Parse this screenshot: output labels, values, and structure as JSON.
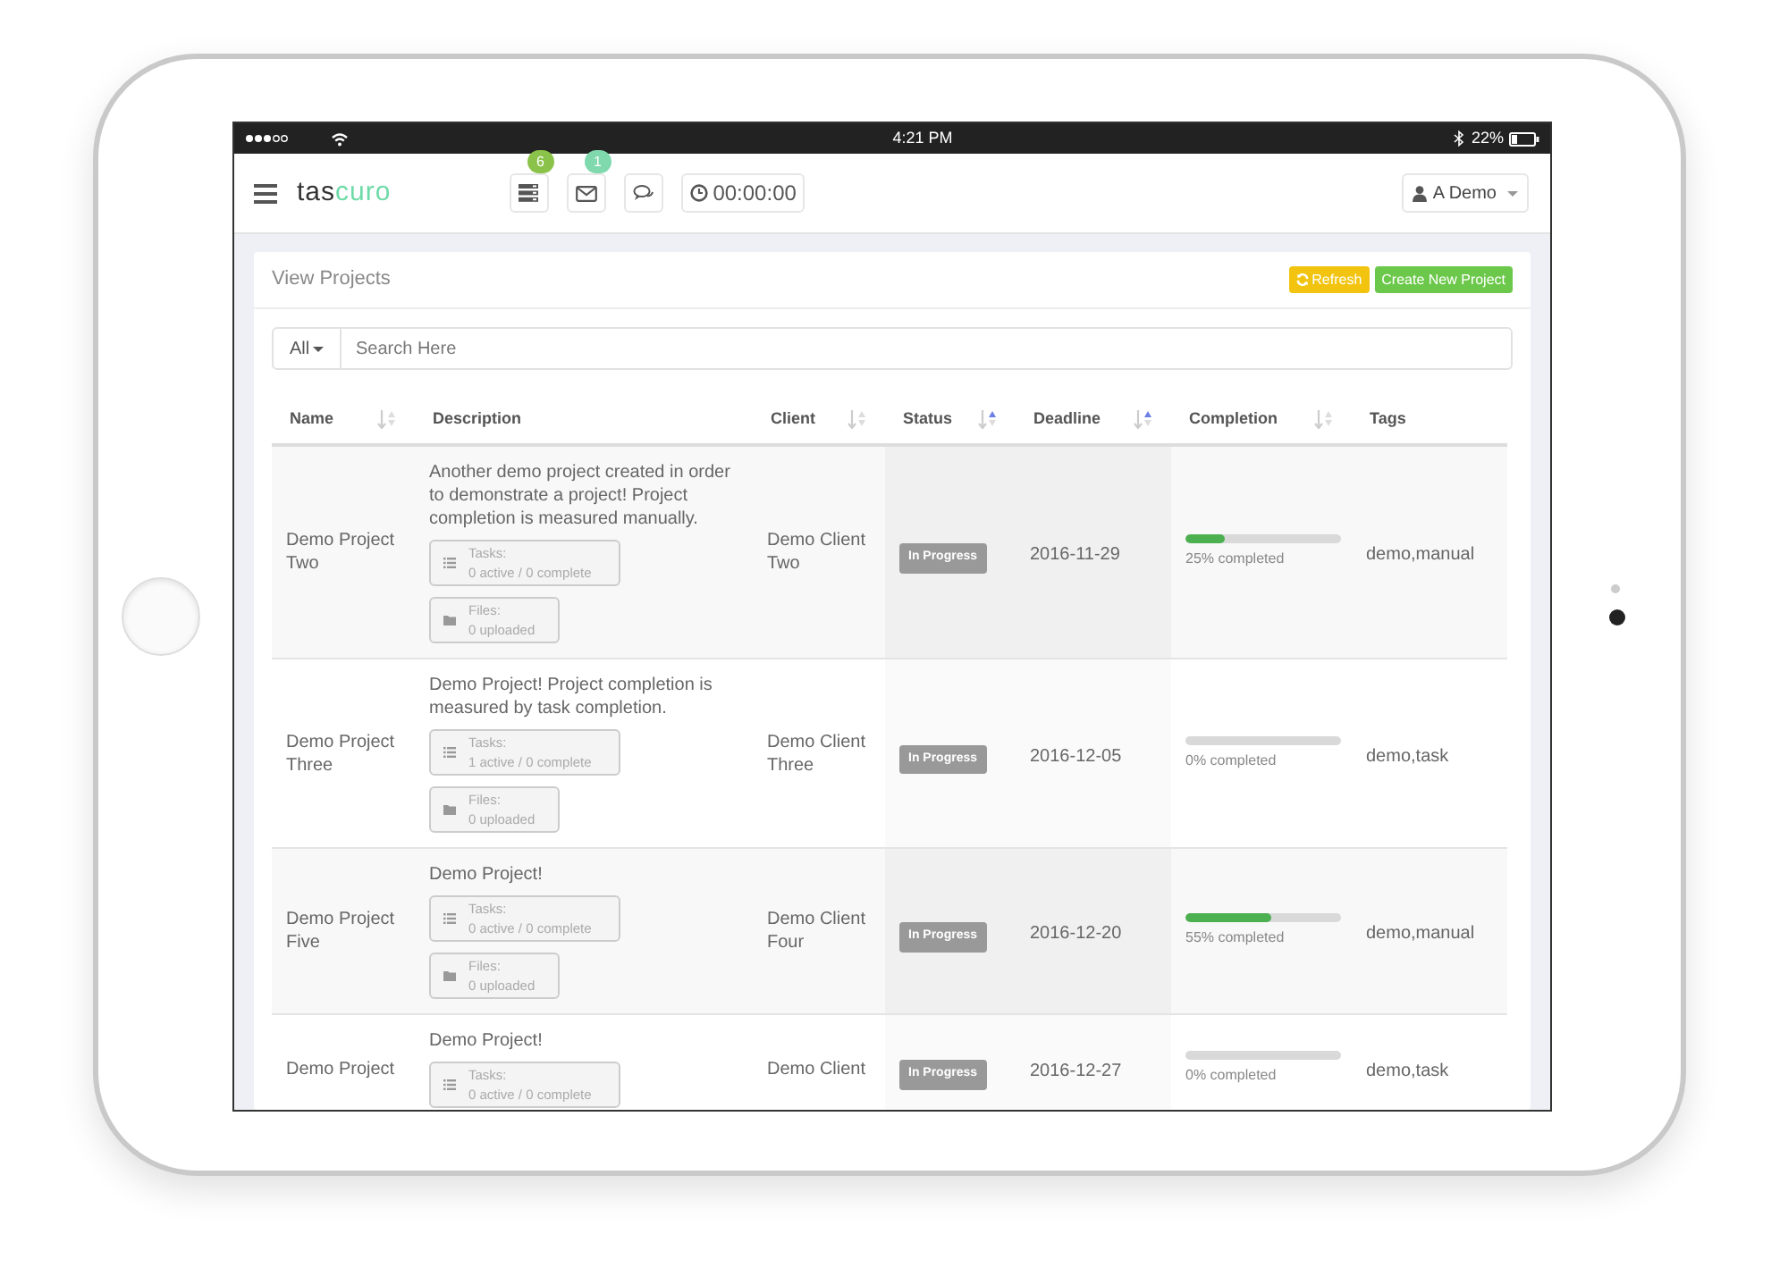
{
  "status_bar": {
    "time": "4:21 PM",
    "battery": "22%"
  },
  "header": {
    "logo": {
      "first": "tas",
      "second": "curo"
    },
    "icon_buttons": [
      {
        "kind": "tasks",
        "badge": "6",
        "color": "#8bc34a"
      },
      {
        "kind": "mail",
        "badge": "1",
        "color": "#7fd9ad"
      },
      {
        "kind": "chat"
      }
    ],
    "timer": "00:00:00",
    "user": "A Demo"
  },
  "panel": {
    "title": "View Projects",
    "buttons": [
      {
        "kind": "refresh",
        "label": "Refresh"
      },
      {
        "kind": "create",
        "label": "Create New Project"
      }
    ],
    "filter": "All",
    "search": {
      "placeholder": "Search Here"
    }
  },
  "table": {
    "columns": [
      {
        "label": "Name",
        "kind": "sortable",
        "sorted": false
      },
      {
        "label": "Description",
        "kind": "plain"
      },
      {
        "label": "Client",
        "kind": "sortable",
        "sorted": false
      },
      {
        "label": "Status",
        "kind": "sortable",
        "sorted": true
      },
      {
        "label": "Deadline",
        "kind": "sortable",
        "sorted": true
      },
      {
        "label": "Completion",
        "kind": "sortable",
        "sorted": false
      },
      {
        "label": "Tags",
        "kind": "plain"
      }
    ],
    "rows": [
      {
        "name": "Demo Project Two",
        "description": "Another demo project created in order to demonstrate a project! Project completion is measured manually.",
        "tasks_label": "Tasks:",
        "tasks": "0 active / 0 complete",
        "files_label": "Files:",
        "files": "0 uploaded",
        "client": "Demo Client Two",
        "status": "In Progress",
        "deadline": "2016-11-29",
        "level": 0.25,
        "completion": "25% completed",
        "tags": "demo,manual"
      },
      {
        "name": "Demo Project Three",
        "description": "Demo Project! Project completion is measured by task completion.",
        "tasks_label": "Tasks:",
        "tasks": "1 active / 0 complete",
        "files_label": "Files:",
        "files": "0 uploaded",
        "client": "Demo Client Three",
        "status": "In Progress",
        "deadline": "2016-12-05",
        "level": 0,
        "completion": "0% completed",
        "tags": "demo,task"
      },
      {
        "name": "Demo Project Five",
        "description": "Demo Project!",
        "tasks_label": "Tasks:",
        "tasks": "0 active / 0 complete",
        "files_label": "Files:",
        "files": "0 uploaded",
        "client": "Demo Client Four",
        "status": "In Progress",
        "deadline": "2016-12-20",
        "level": 0.55,
        "completion": "55% completed",
        "tags": "demo,manual"
      },
      {
        "name": "Demo Project",
        "description": "Demo Project!",
        "tasks_label": "Tasks:",
        "tasks": "0 active / 0 complete",
        "client": "Demo Client",
        "status": "In Progress",
        "deadline": "2016-12-27",
        "level": 0,
        "completion": "0% completed",
        "tags": "demo,task"
      }
    ]
  }
}
